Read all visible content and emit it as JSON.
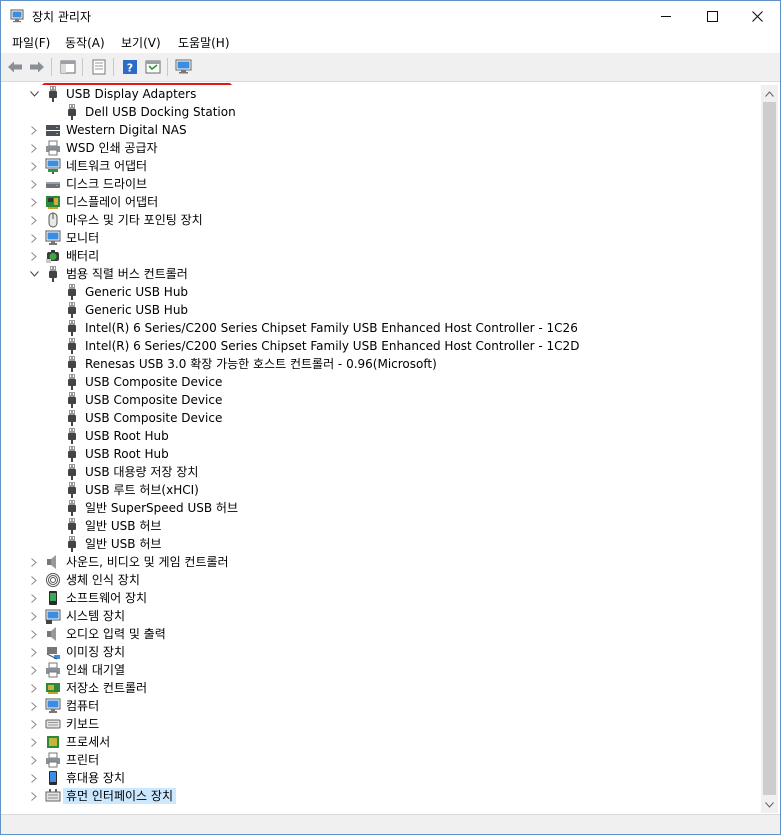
{
  "window": {
    "title": "장치 관리자"
  },
  "menu": {
    "items": [
      "파일(F)",
      "동작(A)",
      "보기(V)",
      "도움말(H)"
    ]
  },
  "tree": {
    "rows": [
      {
        "label": "USB Display Adapters",
        "level": 0,
        "expanded": true,
        "icon": "usb-plug-icon"
      },
      {
        "label": "Dell USB Docking Station",
        "level": 1,
        "icon": "usb-plug-icon"
      },
      {
        "label": "Western Digital NAS",
        "level": 0,
        "expanded": false,
        "icon": "nas-drive-icon"
      },
      {
        "label": "WSD 인쇄 공급자",
        "level": 0,
        "expanded": false,
        "icon": "printer-icon"
      },
      {
        "label": "네트워크 어댑터",
        "level": 0,
        "expanded": false,
        "icon": "network-adapter-icon"
      },
      {
        "label": "디스크 드라이브",
        "level": 0,
        "expanded": false,
        "icon": "disk-drive-icon"
      },
      {
        "label": "디스플레이 어댑터",
        "level": 0,
        "expanded": false,
        "icon": "display-adapter-icon"
      },
      {
        "label": "마우스 및 기타 포인팅 장치",
        "level": 0,
        "expanded": false,
        "icon": "mouse-icon"
      },
      {
        "label": "모니터",
        "level": 0,
        "expanded": false,
        "icon": "monitor-icon"
      },
      {
        "label": "배터리",
        "level": 0,
        "expanded": false,
        "icon": "battery-icon"
      },
      {
        "label": "범용 직렬 버스 컨트롤러",
        "level": 0,
        "expanded": true,
        "icon": "usb-plug-icon"
      },
      {
        "label": "Generic USB Hub",
        "level": 1,
        "icon": "usb-plug-icon"
      },
      {
        "label": "Generic USB Hub",
        "level": 1,
        "icon": "usb-plug-icon"
      },
      {
        "label": "Intel(R) 6 Series/C200 Series Chipset Family USB Enhanced Host Controller - 1C26",
        "level": 1,
        "icon": "usb-plug-icon"
      },
      {
        "label": "Intel(R) 6 Series/C200 Series Chipset Family USB Enhanced Host Controller - 1C2D",
        "level": 1,
        "icon": "usb-plug-icon"
      },
      {
        "label": "Renesas USB 3.0 확장 가능한 호스트 컨트롤러 - 0.96(Microsoft)",
        "level": 1,
        "icon": "usb-plug-icon"
      },
      {
        "label": "USB Composite Device",
        "level": 1,
        "icon": "usb-plug-icon"
      },
      {
        "label": "USB Composite Device",
        "level": 1,
        "icon": "usb-plug-icon"
      },
      {
        "label": "USB Composite Device",
        "level": 1,
        "icon": "usb-plug-icon"
      },
      {
        "label": "USB Root Hub",
        "level": 1,
        "icon": "usb-plug-icon"
      },
      {
        "label": "USB Root Hub",
        "level": 1,
        "icon": "usb-plug-icon"
      },
      {
        "label": "USB 대용량 저장 장치",
        "level": 1,
        "icon": "usb-plug-icon"
      },
      {
        "label": "USB 루트 허브(xHCI)",
        "level": 1,
        "icon": "usb-plug-icon"
      },
      {
        "label": "일반 SuperSpeed USB 허브",
        "level": 1,
        "icon": "usb-plug-icon"
      },
      {
        "label": "일반 USB 허브",
        "level": 1,
        "icon": "usb-plug-icon"
      },
      {
        "label": "일반 USB 허브",
        "level": 1,
        "icon": "usb-plug-icon"
      },
      {
        "label": "사운드, 비디오 및 게임 컨트롤러",
        "level": 0,
        "expanded": false,
        "icon": "speaker-icon"
      },
      {
        "label": "생체 인식 장치",
        "level": 0,
        "expanded": false,
        "icon": "fingerprint-icon"
      },
      {
        "label": "소프트웨어 장치",
        "level": 0,
        "expanded": false,
        "icon": "software-device-icon"
      },
      {
        "label": "시스템 장치",
        "level": 0,
        "expanded": false,
        "icon": "system-device-icon"
      },
      {
        "label": "오디오 입력 및 출력",
        "level": 0,
        "expanded": false,
        "icon": "speaker-icon"
      },
      {
        "label": "이미징 장치",
        "level": 0,
        "expanded": false,
        "icon": "camera-icon"
      },
      {
        "label": "인쇄 대기열",
        "level": 0,
        "expanded": false,
        "icon": "printer-icon"
      },
      {
        "label": "저장소 컨트롤러",
        "level": 0,
        "expanded": false,
        "icon": "storage-controller-icon"
      },
      {
        "label": "컴퓨터",
        "level": 0,
        "expanded": false,
        "icon": "computer-icon"
      },
      {
        "label": "키보드",
        "level": 0,
        "expanded": false,
        "icon": "keyboard-icon"
      },
      {
        "label": "프로세서",
        "level": 0,
        "expanded": false,
        "icon": "processor-icon"
      },
      {
        "label": "프린터",
        "level": 0,
        "expanded": false,
        "icon": "printer-icon"
      },
      {
        "label": "휴대용 장치",
        "level": 0,
        "expanded": false,
        "icon": "portable-device-icon"
      },
      {
        "label": "휴먼 인터페이스 장치",
        "level": 0,
        "expanded": false,
        "icon": "hid-icon",
        "selected": true
      }
    ]
  },
  "colors": {
    "highlight": "#e01818",
    "selection": "#cce8ff",
    "accent": "#2c7bd6"
  }
}
